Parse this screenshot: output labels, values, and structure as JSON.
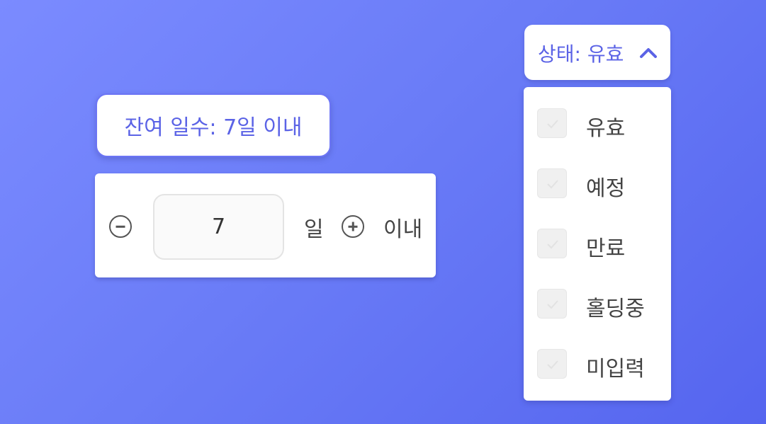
{
  "remaining_days_chip": {
    "label": "잔여 일수: 7일 이내"
  },
  "stepper": {
    "value": "7",
    "unit": "일",
    "suffix": "이내"
  },
  "status_filter": {
    "label": "상태: 유효",
    "expanded": true,
    "options": [
      {
        "label": "유효",
        "checked": false
      },
      {
        "label": "예정",
        "checked": false
      },
      {
        "label": "만료",
        "checked": false
      },
      {
        "label": "홀딩중",
        "checked": false
      },
      {
        "label": "미입력",
        "checked": false
      }
    ]
  },
  "colors": {
    "accent": "#5b63e6",
    "background_start": "#7b8bff",
    "background_end": "#5565ef"
  },
  "icons": {
    "minus": "minus-circle-icon",
    "plus": "plus-circle-icon",
    "chevron": "chevron-up-icon",
    "check": "check-icon"
  }
}
